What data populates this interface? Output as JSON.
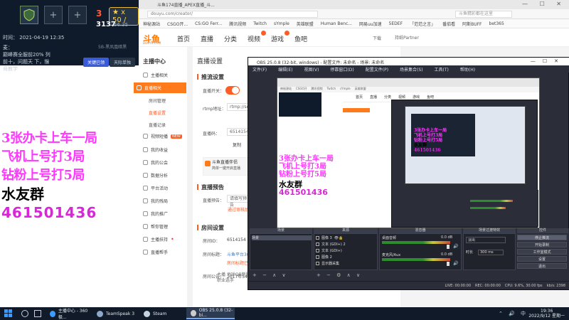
{
  "overlay": {
    "tile_plus": "+",
    "badge": "3",
    "x50": "★ x 50 /",
    "level": "3137",
    "level_sub": "56.35",
    "time_label": "时间：",
    "time_value": "2021-04-19 12:35",
    "mic_label": "麦：",
    "mic_text": "巅峰赛全服前20% 列前十，问题天 下，猴哥教学",
    "fight": "5B-黑凤凰暗黑",
    "btn_primary": "关键已领",
    "btn_secondary": "天际单独"
  },
  "browser": {
    "tab_title": "斗鱼174直播_APEX直播_斗...",
    "address": "douyu.com/creator/",
    "search_placeholder": "斗鱼精彩都在这里",
    "bookmarks": [
      "神秘源站",
      "CSGO开...",
      "CS:GO Ferr...",
      "腾讯视频",
      "Twitch",
      "sYmple",
      "英雄联盟",
      "Human Benc...",
      "网易uu加速",
      "5EDEF",
      "「范范之言」",
      "番茄看",
      "阿斯BUFF",
      "bet365"
    ],
    "window_controls": "— ☐ ✕"
  },
  "site": {
    "logo": "斗鱼",
    "logo_sub": "DOUYU.COM",
    "nav": [
      "首页",
      "直播",
      "分类",
      "视频",
      "游戏",
      "鱼吧"
    ],
    "download": "下载",
    "user": "持纸Partner"
  },
  "sidebar": {
    "title": "主播中心",
    "items": [
      {
        "label": "主播相关"
      },
      {
        "label": "直播相关"
      },
      {
        "label": "房间管理"
      },
      {
        "label": "直播设置"
      },
      {
        "label": "直播记录"
      },
      {
        "label": "视频短播",
        "badge": "NEW"
      },
      {
        "label": "我的收益"
      },
      {
        "label": "我的公会"
      },
      {
        "label": "数据分析"
      },
      {
        "label": "平台活动"
      },
      {
        "label": "我的残局"
      },
      {
        "label": "我的推广"
      },
      {
        "label": "帮你管理"
      },
      {
        "label": "主播扶持"
      },
      {
        "label": "直播帮手"
      }
    ]
  },
  "main": {
    "page_title": "直播设置",
    "push_title": "推流设置",
    "live_switch_label": "直播开关：",
    "rtmp_label": "rtmp地址：",
    "rtmp_value": "rtmp://sen",
    "code_label": "直播码：",
    "code_value": "6514154cb",
    "copy": "复制",
    "tip_title": "斗鱼直播伴侣",
    "tip_text": "简单一键开启直播",
    "notice_title": "直播预告",
    "notice_label": "直播预告：",
    "notice_placeholder": "请填写预告",
    "notice_link": "通过审核后显示",
    "room_title": "房间设置",
    "room_id_label": "房间ID：",
    "room_id_value": "6514154",
    "room_name_label": "房间标题：",
    "room_name_value": "斗鱼平台3000",
    "room_name_link": "房间标题已更新",
    "room_notice_label": "房间公告：",
    "room_notice_value": "2017年54...",
    "room_desc": "主播 地球OB新服，想带粉10 保持送牌前 2500分 使打最牛 最有 名直接把胶打出职业选手"
  },
  "promo": {
    "line1": "3张办卡上车一局",
    "line2": "飞机上号打3局",
    "line3": "钻粉上号打5局",
    "group": "水友群",
    "qq": "461501436"
  },
  "obs": {
    "title": "OBS 25.0.8 (32-bit, windows) - 配置文件: 未命名 - 场景: 未命名",
    "menu": [
      "文件(F)",
      "编辑(E)",
      "视图(V)",
      "停靠窗口(D)",
      "配置文件(P)",
      "场景集合(S)",
      "工具(T)",
      "帮助(H)"
    ],
    "dock_headers": [
      "场景",
      "来源",
      "混音器",
      "场景过渡特效",
      "控件"
    ],
    "scenes": [
      "场景"
    ],
    "sources": [
      "图像 3",
      "文本 (GDI+) 2",
      "文本 (GDI+)",
      "图像 2",
      "显示器采集"
    ],
    "mixer": [
      {
        "name": "桌面音频",
        "db": "0.0 dB"
      },
      {
        "name": "麦克风/Aux",
        "db": "0.0 dB"
      }
    ],
    "transition_type": "淡出",
    "duration_label": "时长",
    "duration_value": "300 ms",
    "controls": [
      "停止推流",
      "开始录制",
      "工作室模式",
      "设置",
      "退出"
    ],
    "status": [
      "LIVE: 00:00:00",
      "REC: 00:00:00",
      "CPU: 9.6%, 30.00 fps",
      "kb/s: 2398"
    ]
  },
  "nested": {
    "bookmarks": [
      "神秘源站",
      "CSGO开",
      "腾讯视频",
      "Twitch",
      "sYmple",
      "英雄联盟"
    ],
    "nav": [
      "首页",
      "直播",
      "分类",
      "视频",
      "游戏",
      "鱼吧"
    ]
  },
  "taskbar": {
    "apps": [
      {
        "label": "主播中心 - 360极...",
        "color": "#3b9bff"
      },
      {
        "label": "TeamSpeak 3",
        "color": "#8fa8c8"
      },
      {
        "label": "Steam",
        "color": "#c6d4df"
      },
      {
        "label": "OBS 25.0.8 (32-bi...",
        "color": "#cccccc"
      }
    ],
    "tray": "⌃ 🔊 中",
    "time": "19:36",
    "date": "2022/9/12 星期一"
  }
}
